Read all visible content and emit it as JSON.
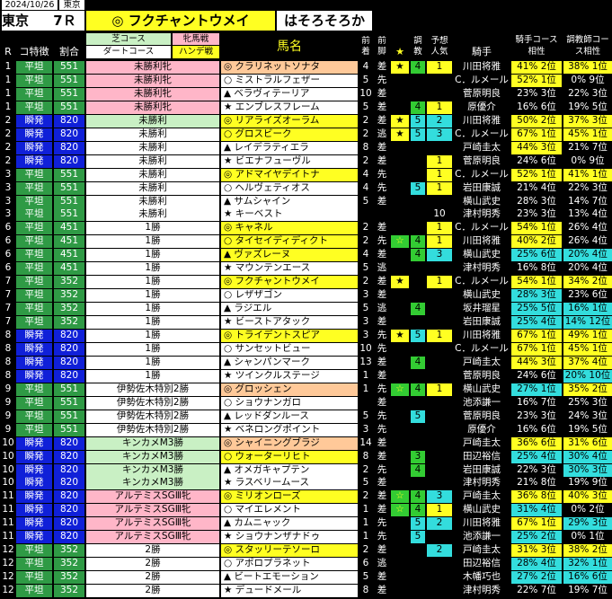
{
  "header": {
    "date": "2024/10/26",
    "venue_tag": "東京",
    "venue": "東京",
    "race": "7Ｒ",
    "pick_mark": "◎",
    "pick_horse": "フクチャントウメイ",
    "pick_comment": "はそろそろか",
    "legend_turf": "芝コース",
    "legend_dirt": "ダートコース",
    "legend_filly": "牝馬戦",
    "legend_handicap": "ハンデ戦"
  },
  "columns": {
    "r": "R",
    "course_feature": "コ特徴",
    "ratio": "割合",
    "horse": "馬名",
    "prev_finish": "前着",
    "prev_style": "前脚",
    "star": "★",
    "training": "調教",
    "pop": "予想人気",
    "jockey": "騎手",
    "jockey_fit": "騎手コース相性",
    "trainer_fit": "調教師コース相性"
  },
  "colors": {
    "flat": "#2f9a45",
    "burst": "#1020d8",
    "filly": "#ffb6c8",
    "turf": "#c9f0c4",
    "yellow": "#ffff22",
    "peach": "#ffc999",
    "cyan": "#33dddd",
    "green_mark": "#33cc33"
  },
  "rows": [
    {
      "r": "1",
      "feat": "平坦",
      "ratio": "551",
      "cls": "未勝利牝",
      "mark": "◎",
      "name": "クラリネットソナタ",
      "prev": "4",
      "style": "差",
      "star": "★",
      "star_c": "yellow",
      "trn": "4",
      "trn_c": "green",
      "pop": "1",
      "pop_c": "yellow",
      "jockey": "川田将雅",
      "jf": "41% 2位",
      "jf_c": "yellow",
      "tf": "38% 1位",
      "tf_c": "yellow",
      "name_c": "peach",
      "cls_c": "pink"
    },
    {
      "r": "1",
      "feat": "平坦",
      "ratio": "551",
      "cls": "未勝利牝",
      "mark": "○",
      "name": "ミストラルフェザー",
      "prev": "5",
      "style": "先",
      "star": "",
      "star_c": "",
      "trn": "",
      "trn_c": "",
      "pop": "",
      "pop_c": "",
      "jockey": "C．ルメール",
      "jf": "52% 1位",
      "jf_c": "yellow",
      "tf": "0% 9位",
      "tf_c": "",
      "name_c": "",
      "cls_c": "pink"
    },
    {
      "r": "1",
      "feat": "平坦",
      "ratio": "551",
      "cls": "未勝利牝",
      "mark": "▲",
      "name": "ベラヴィテーリア",
      "prev": "10",
      "style": "差",
      "star": "",
      "star_c": "",
      "trn": "",
      "trn_c": "",
      "pop": "",
      "pop_c": "",
      "jockey": "菅原明良",
      "jf": "23% 3位",
      "jf_c": "",
      "tf": "22% 3位",
      "tf_c": "",
      "name_c": "",
      "cls_c": "pink"
    },
    {
      "r": "1",
      "feat": "平坦",
      "ratio": "551",
      "cls": "未勝利牝",
      "mark": "★",
      "name": "エンブレスフレーム",
      "prev": "5",
      "style": "差",
      "star": "",
      "star_c": "",
      "trn": "4",
      "trn_c": "green",
      "pop": "1",
      "pop_c": "yellow",
      "jockey": "原優介",
      "jf": "16% 6位",
      "jf_c": "",
      "tf": "19% 5位",
      "tf_c": "",
      "name_c": "",
      "cls_c": "pink"
    },
    {
      "r": "2",
      "feat": "瞬発",
      "ratio": "820",
      "cls": "未勝利",
      "mark": "◎",
      "name": "リアライズオーラム",
      "prev": "2",
      "style": "差",
      "star": "★",
      "star_c": "yellow",
      "trn": "5",
      "trn_c": "cyan",
      "pop": "2",
      "pop_c": "cyan",
      "jockey": "川田将雅",
      "jf": "50% 2位",
      "jf_c": "yellow",
      "tf": "37% 3位",
      "tf_c": "yellow",
      "name_c": "yellow",
      "cls_c": "lgreen"
    },
    {
      "r": "2",
      "feat": "瞬発",
      "ratio": "820",
      "cls": "未勝利",
      "mark": "○",
      "name": "グロスビーク",
      "prev": "2",
      "style": "逃",
      "star": "★",
      "star_c": "yellow",
      "trn": "5",
      "trn_c": "cyan",
      "pop": "3",
      "pop_c": "cyan",
      "jockey": "C．ルメール",
      "jf": "67% 1位",
      "jf_c": "yellow",
      "tf": "45% 1位",
      "tf_c": "yellow",
      "name_c": "yellow",
      "cls_c": ""
    },
    {
      "r": "2",
      "feat": "瞬発",
      "ratio": "820",
      "cls": "未勝利",
      "mark": "▲",
      "name": "レイデラティエラ",
      "prev": "8",
      "style": "差",
      "star": "",
      "star_c": "",
      "trn": "",
      "trn_c": "",
      "pop": "",
      "pop_c": "",
      "jockey": "戸崎圭太",
      "jf": "44% 3位",
      "jf_c": "yellow",
      "tf": "21% 7位",
      "tf_c": "",
      "name_c": "",
      "cls_c": ""
    },
    {
      "r": "2",
      "feat": "瞬発",
      "ratio": "820",
      "cls": "未勝利",
      "mark": "★",
      "name": "ビエナフューヴル",
      "prev": "2",
      "style": "差",
      "star": "",
      "star_c": "",
      "trn": "",
      "trn_c": "",
      "pop": "1",
      "pop_c": "yellow",
      "jockey": "菅原明良",
      "jf": "24% 6位",
      "jf_c": "",
      "tf": "0% 9位",
      "tf_c": "",
      "name_c": "",
      "cls_c": ""
    },
    {
      "r": "3",
      "feat": "平坦",
      "ratio": "551",
      "cls": "未勝利",
      "mark": "◎",
      "name": "アドマイヤデイトナ",
      "prev": "4",
      "style": "先",
      "star": "",
      "star_c": "",
      "trn": "",
      "trn_c": "",
      "pop": "1",
      "pop_c": "yellow",
      "jockey": "C．ルメール",
      "jf": "52% 1位",
      "jf_c": "yellow",
      "tf": "41% 1位",
      "tf_c": "yellow",
      "name_c": "yellow",
      "cls_c": ""
    },
    {
      "r": "3",
      "feat": "平坦",
      "ratio": "551",
      "cls": "未勝利",
      "mark": "○",
      "name": "ヘルヴェティオス",
      "prev": "4",
      "style": "先",
      "star": "",
      "star_c": "",
      "trn": "5",
      "trn_c": "cyan",
      "pop": "1",
      "pop_c": "yellow",
      "jockey": "岩田康誠",
      "jf": "21% 4位",
      "jf_c": "",
      "tf": "22% 3位",
      "tf_c": "",
      "name_c": "",
      "cls_c": ""
    },
    {
      "r": "3",
      "feat": "平坦",
      "ratio": "551",
      "cls": "未勝利",
      "mark": "▲",
      "name": "サムシャイン",
      "prev": "5",
      "style": "差",
      "star": "",
      "star_c": "",
      "trn": "",
      "trn_c": "",
      "pop": "",
      "pop_c": "",
      "jockey": "横山武史",
      "jf": "28% 3位",
      "jf_c": "",
      "tf": "14% 7位",
      "tf_c": "",
      "name_c": "",
      "cls_c": ""
    },
    {
      "r": "3",
      "feat": "平坦",
      "ratio": "551",
      "cls": "未勝利",
      "mark": "★",
      "name": "キーベスト",
      "prev": "",
      "style": "",
      "star": "",
      "star_c": "",
      "trn": "",
      "trn_c": "",
      "pop": "10",
      "pop_c": "",
      "jockey": "津村明秀",
      "jf": "23% 3位",
      "jf_c": "",
      "tf": "13% 4位",
      "tf_c": "",
      "name_c": "",
      "cls_c": ""
    },
    {
      "r": "6",
      "feat": "平坦",
      "ratio": "451",
      "cls": "1勝",
      "mark": "◎",
      "name": "キャネル",
      "prev": "2",
      "style": "差",
      "star": "",
      "star_c": "",
      "trn": "",
      "trn_c": "",
      "pop": "1",
      "pop_c": "yellow",
      "jockey": "C．ルメール",
      "jf": "54% 1位",
      "jf_c": "yellow",
      "tf": "26% 4位",
      "tf_c": "",
      "name_c": "yellow",
      "cls_c": ""
    },
    {
      "r": "6",
      "feat": "平坦",
      "ratio": "451",
      "cls": "1勝",
      "mark": "○",
      "name": "タイセイディディクト",
      "prev": "2",
      "style": "先",
      "star": "☆",
      "star_c": "green",
      "trn": "4",
      "trn_c": "green",
      "pop": "1",
      "pop_c": "yellow",
      "jockey": "川田将雅",
      "jf": "40% 2位",
      "jf_c": "yellow",
      "tf": "26% 4位",
      "tf_c": "",
      "name_c": "yellow",
      "cls_c": ""
    },
    {
      "r": "6",
      "feat": "平坦",
      "ratio": "451",
      "cls": "1勝",
      "mark": "▲",
      "name": "ヴァズレーヌ",
      "prev": "4",
      "style": "差",
      "star": "",
      "star_c": "",
      "trn": "4",
      "trn_c": "green",
      "pop": "3",
      "pop_c": "cyan",
      "jockey": "横山武史",
      "jf": "25% 6位",
      "jf_c": "cyan",
      "tf": "20% 4位",
      "tf_c": "cyan",
      "name_c": "yellow",
      "cls_c": ""
    },
    {
      "r": "6",
      "feat": "平坦",
      "ratio": "451",
      "cls": "1勝",
      "mark": "★",
      "name": "マウンテンエース",
      "prev": "5",
      "style": "逃",
      "star": "",
      "star_c": "",
      "trn": "",
      "trn_c": "",
      "pop": "",
      "pop_c": "",
      "jockey": "津村明秀",
      "jf": "16% 8位",
      "jf_c": "",
      "tf": "20% 4位",
      "tf_c": "",
      "name_c": "",
      "cls_c": ""
    },
    {
      "r": "7",
      "feat": "平坦",
      "ratio": "352",
      "cls": "1勝",
      "mark": "◎",
      "name": "フクチャントウメイ",
      "prev": "2",
      "style": "差",
      "star": "★",
      "star_c": "yellow",
      "trn": "",
      "trn_c": "",
      "pop": "1",
      "pop_c": "yellow",
      "jockey": "C．ルメール",
      "jf": "54% 1位",
      "jf_c": "yellow",
      "tf": "34% 2位",
      "tf_c": "yellow",
      "name_c": "yellow",
      "cls_c": ""
    },
    {
      "r": "7",
      "feat": "平坦",
      "ratio": "352",
      "cls": "1勝",
      "mark": "○",
      "name": "レザザゴン",
      "prev": "3",
      "style": "差",
      "star": "",
      "star_c": "",
      "trn": "",
      "trn_c": "",
      "pop": "",
      "pop_c": "",
      "jockey": "横山武史",
      "jf": "28% 3位",
      "jf_c": "cyan",
      "tf": "23% 6位",
      "tf_c": "",
      "name_c": "",
      "cls_c": ""
    },
    {
      "r": "7",
      "feat": "平坦",
      "ratio": "352",
      "cls": "1勝",
      "mark": "▲",
      "name": "ラジエル",
      "prev": "5",
      "style": "逃",
      "star": "",
      "star_c": "",
      "trn": "4",
      "trn_c": "green",
      "pop": "",
      "pop_c": "",
      "jockey": "坂井瑠星",
      "jf": "25% 5位",
      "jf_c": "cyan",
      "tf": "16% 1位",
      "tf_c": "cyan",
      "name_c": "",
      "cls_c": ""
    },
    {
      "r": "7",
      "feat": "平坦",
      "ratio": "352",
      "cls": "1勝",
      "mark": "★",
      "name": "ビーストアタック",
      "prev": "3",
      "style": "差",
      "star": "",
      "star_c": "",
      "trn": "",
      "trn_c": "",
      "pop": "",
      "pop_c": "",
      "jockey": "岩田康誠",
      "jf": "25% 4位",
      "jf_c": "cyan",
      "tf": "14% 12位",
      "tf_c": "cyan",
      "name_c": "",
      "cls_c": ""
    },
    {
      "r": "8",
      "feat": "瞬発",
      "ratio": "820",
      "cls": "1勝",
      "mark": "◎",
      "name": "トライデントスピア",
      "prev": "3",
      "style": "先",
      "star": "★",
      "star_c": "yellow",
      "trn": "5",
      "trn_c": "cyan",
      "pop": "1",
      "pop_c": "yellow",
      "jockey": "川田将雅",
      "jf": "67% 1位",
      "jf_c": "yellow",
      "tf": "49% 1位",
      "tf_c": "yellow",
      "name_c": "yellow",
      "cls_c": ""
    },
    {
      "r": "8",
      "feat": "瞬発",
      "ratio": "820",
      "cls": "1勝",
      "mark": "○",
      "name": "サンセットビュー",
      "prev": "10",
      "style": "先",
      "star": "",
      "star_c": "",
      "trn": "",
      "trn_c": "",
      "pop": "",
      "pop_c": "",
      "jockey": "C．ルメール",
      "jf": "67% 1位",
      "jf_c": "yellow",
      "tf": "45% 1位",
      "tf_c": "yellow",
      "name_c": "",
      "cls_c": ""
    },
    {
      "r": "8",
      "feat": "瞬発",
      "ratio": "820",
      "cls": "1勝",
      "mark": "▲",
      "name": "シャンパンマーク",
      "prev": "13",
      "style": "差",
      "star": "",
      "star_c": "",
      "trn": "4",
      "trn_c": "green",
      "pop": "",
      "pop_c": "",
      "jockey": "戸崎圭太",
      "jf": "44% 3位",
      "jf_c": "yellow",
      "tf": "37% 4位",
      "tf_c": "yellow",
      "name_c": "",
      "cls_c": ""
    },
    {
      "r": "8",
      "feat": "瞬発",
      "ratio": "820",
      "cls": "1勝",
      "mark": "★",
      "name": "ツインクルステージ",
      "prev": "1",
      "style": "差",
      "star": "",
      "star_c": "",
      "trn": "",
      "trn_c": "",
      "pop": "",
      "pop_c": "",
      "jockey": "菅原明良",
      "jf": "24% 6位",
      "jf_c": "",
      "tf": "20% 10位",
      "tf_c": "cyan",
      "name_c": "",
      "cls_c": ""
    },
    {
      "r": "9",
      "feat": "平坦",
      "ratio": "551",
      "cls": "伊勢佐木特別2勝",
      "mark": "◎",
      "name": "グロッシェン",
      "prev": "1",
      "style": "先",
      "star": "☆",
      "star_c": "green",
      "trn": "4",
      "trn_c": "green",
      "pop": "1",
      "pop_c": "yellow",
      "jockey": "横山武史",
      "jf": "27% 1位",
      "jf_c": "cyan",
      "tf": "35% 2位",
      "tf_c": "yellow",
      "name_c": "peach",
      "cls_c": ""
    },
    {
      "r": "9",
      "feat": "平坦",
      "ratio": "551",
      "cls": "伊勢佐木特別2勝",
      "mark": "○",
      "name": "ショウナンガロ",
      "prev": "",
      "style": "差",
      "star": "",
      "star_c": "",
      "trn": "",
      "trn_c": "",
      "pop": "",
      "pop_c": "",
      "jockey": "池添謙一",
      "jf": "16% 7位",
      "jf_c": "",
      "tf": "25% 3位",
      "tf_c": "",
      "name_c": "",
      "cls_c": ""
    },
    {
      "r": "9",
      "feat": "平坦",
      "ratio": "551",
      "cls": "伊勢佐木特別2勝",
      "mark": "▲",
      "name": "レッドダンルース",
      "prev": "5",
      "style": "先",
      "star": "",
      "star_c": "",
      "trn": "5",
      "trn_c": "cyan",
      "pop": "",
      "pop_c": "",
      "jockey": "菅原明良",
      "jf": "23% 3位",
      "jf_c": "",
      "tf": "24% 3位",
      "tf_c": "",
      "name_c": "",
      "cls_c": ""
    },
    {
      "r": "9",
      "feat": "平坦",
      "ratio": "551",
      "cls": "伊勢佐木特別2勝",
      "mark": "★",
      "name": "ベネロングポイント",
      "prev": "3",
      "style": "先",
      "star": "",
      "star_c": "",
      "trn": "",
      "trn_c": "",
      "pop": "",
      "pop_c": "",
      "jockey": "原優介",
      "jf": "16% 6位",
      "jf_c": "",
      "tf": "19% 5位",
      "tf_c": "",
      "name_c": "",
      "cls_c": ""
    },
    {
      "r": "10",
      "feat": "瞬発",
      "ratio": "820",
      "cls": "キンカメM3勝",
      "mark": "◎",
      "name": "シャイニングブラジ",
      "prev": "14",
      "style": "差",
      "star": "",
      "star_c": "",
      "trn": "",
      "trn_c": "",
      "pop": "",
      "pop_c": "",
      "jockey": "戸崎圭太",
      "jf": "36% 6位",
      "jf_c": "yellow",
      "tf": "31% 6位",
      "tf_c": "yellow",
      "name_c": "peach",
      "cls_c": "lgreen"
    },
    {
      "r": "10",
      "feat": "瞬発",
      "ratio": "820",
      "cls": "キンカメM3勝",
      "mark": "○",
      "name": "ウォーターリヒト",
      "prev": "8",
      "style": "差",
      "star": "",
      "star_c": "",
      "trn": "3",
      "trn_c": "green",
      "pop": "",
      "pop_c": "",
      "jockey": "田辺裕信",
      "jf": "25% 4位",
      "jf_c": "cyan",
      "tf": "30% 4位",
      "tf_c": "cyan",
      "name_c": "yellow",
      "cls_c": "lgreen"
    },
    {
      "r": "10",
      "feat": "瞬発",
      "ratio": "820",
      "cls": "キンカメM3勝",
      "mark": "▲",
      "name": "オメガキャプテン",
      "prev": "2",
      "style": "先",
      "star": "",
      "star_c": "",
      "trn": "4",
      "trn_c": "green",
      "pop": "",
      "pop_c": "",
      "jockey": "岩田康誠",
      "jf": "22% 3位",
      "jf_c": "",
      "tf": "30% 3位",
      "tf_c": "cyan",
      "name_c": "",
      "cls_c": "lgreen"
    },
    {
      "r": "10",
      "feat": "瞬発",
      "ratio": "820",
      "cls": "キンカメM3勝",
      "mark": "★",
      "name": "ラスベリームース",
      "prev": "5",
      "style": "差",
      "star": "",
      "star_c": "",
      "trn": "",
      "trn_c": "",
      "pop": "",
      "pop_c": "",
      "jockey": "津村明秀",
      "jf": "21% 8位",
      "jf_c": "",
      "tf": "19% 9位",
      "tf_c": "",
      "name_c": "",
      "cls_c": "lgreen"
    },
    {
      "r": "11",
      "feat": "瞬発",
      "ratio": "820",
      "cls": "アルテミスSGⅢ牝",
      "mark": "◎",
      "name": "ミリオンローズ",
      "prev": "2",
      "style": "差",
      "star": "☆",
      "star_c": "green",
      "trn": "4",
      "trn_c": "green",
      "pop": "3",
      "pop_c": "cyan",
      "jockey": "戸崎圭太",
      "jf": "36% 8位",
      "jf_c": "yellow",
      "tf": "40% 3位",
      "tf_c": "yellow",
      "name_c": "yellow",
      "cls_c": "pink"
    },
    {
      "r": "11",
      "feat": "瞬発",
      "ratio": "820",
      "cls": "アルテミスSGⅢ牝",
      "mark": "○",
      "name": "マイエレメント",
      "prev": "1",
      "style": "差",
      "star": "☆",
      "star_c": "green",
      "trn": "4",
      "trn_c": "green",
      "pop": "1",
      "pop_c": "yellow",
      "jockey": "横山武史",
      "jf": "31% 4位",
      "jf_c": "cyan",
      "tf": "0% 2位",
      "tf_c": "",
      "name_c": "",
      "cls_c": "pink"
    },
    {
      "r": "11",
      "feat": "瞬発",
      "ratio": "820",
      "cls": "アルテミスSGⅢ牝",
      "mark": "▲",
      "name": "カムニャック",
      "prev": "1",
      "style": "先",
      "star": "",
      "star_c": "",
      "trn": "5",
      "trn_c": "cyan",
      "pop": "2",
      "pop_c": "cyan",
      "jockey": "川田将雅",
      "jf": "67% 1位",
      "jf_c": "yellow",
      "tf": "29% 3位",
      "tf_c": "cyan",
      "name_c": "",
      "cls_c": "pink"
    },
    {
      "r": "11",
      "feat": "瞬発",
      "ratio": "820",
      "cls": "アルテミスSGⅢ牝",
      "mark": "★",
      "name": "ショウナンザナドゥ",
      "prev": "1",
      "style": "先",
      "star": "",
      "star_c": "",
      "trn": "5",
      "trn_c": "cyan",
      "pop": "",
      "pop_c": "",
      "jockey": "池添謙一",
      "jf": "25% 2位",
      "jf_c": "cyan",
      "tf": "0% 1位",
      "tf_c": "",
      "name_c": "",
      "cls_c": "pink"
    },
    {
      "r": "12",
      "feat": "平坦",
      "ratio": "352",
      "cls": "2勝",
      "mark": "◎",
      "name": "スタッリーテソーロ",
      "prev": "2",
      "style": "差",
      "star": "",
      "star_c": "",
      "trn": "",
      "trn_c": "",
      "pop": "2",
      "pop_c": "cyan",
      "jockey": "戸崎圭太",
      "jf": "31% 3位",
      "jf_c": "yellow",
      "tf": "38% 2位",
      "tf_c": "yellow",
      "name_c": "yellow",
      "cls_c": ""
    },
    {
      "r": "12",
      "feat": "平坦",
      "ratio": "352",
      "cls": "2勝",
      "mark": "○",
      "name": "アポロプラネット",
      "prev": "6",
      "style": "逃",
      "star": "",
      "star_c": "",
      "trn": "",
      "trn_c": "",
      "pop": "",
      "pop_c": "",
      "jockey": "田辺裕信",
      "jf": "28% 4位",
      "jf_c": "cyan",
      "tf": "32% 1位",
      "tf_c": "cyan",
      "name_c": "",
      "cls_c": ""
    },
    {
      "r": "12",
      "feat": "平坦",
      "ratio": "352",
      "cls": "2勝",
      "mark": "▲",
      "name": "ビートエモーション",
      "prev": "5",
      "style": "差",
      "star": "",
      "star_c": "",
      "trn": "",
      "trn_c": "",
      "pop": "",
      "pop_c": "",
      "jockey": "木幡巧也",
      "jf": "27% 2位",
      "jf_c": "cyan",
      "tf": "16% 6位",
      "tf_c": "cyan",
      "name_c": "",
      "cls_c": ""
    },
    {
      "r": "12",
      "feat": "平坦",
      "ratio": "352",
      "cls": "2勝",
      "mark": "★",
      "name": "デュードメール",
      "prev": "8",
      "style": "差",
      "star": "",
      "star_c": "",
      "trn": "",
      "trn_c": "",
      "pop": "",
      "pop_c": "",
      "jockey": "津村明秀",
      "jf": "22% 7位",
      "jf_c": "",
      "tf": "19% 7位",
      "tf_c": "",
      "name_c": "",
      "cls_c": ""
    }
  ]
}
